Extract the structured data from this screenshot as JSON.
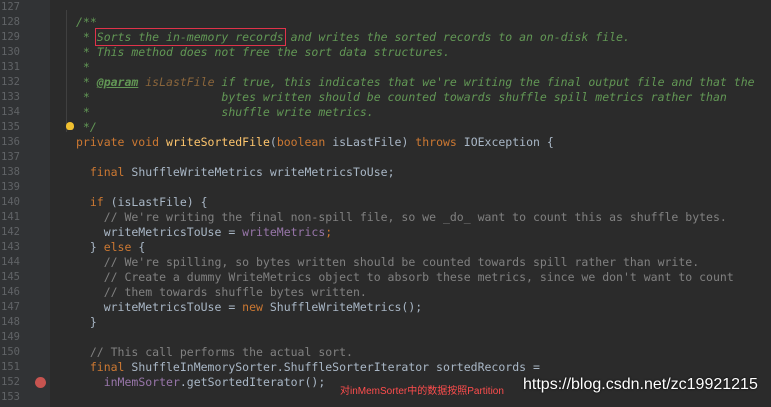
{
  "gutter": {
    "line_numbers": [
      "127",
      "128",
      "129",
      "130",
      "131",
      "132",
      "133",
      "134",
      "135",
      "136",
      "137",
      "138",
      "139",
      "140",
      "141",
      "142",
      "143",
      "144",
      "145",
      "146",
      "147",
      "148",
      "149",
      "150",
      "151",
      "152",
      "153"
    ]
  },
  "code": {
    "l127": "",
    "l128": "/**",
    "l129_pre": " * ",
    "l129_boxed": "Sorts the in-memory records",
    "l129_post": " and writes the sorted records to an on-disk file.",
    "l130": " * This method does not free the sort data structures.",
    "l131": " *",
    "l132_pre": " * ",
    "l132_tag": "@param",
    "l132_param": " isLastFile",
    "l132_post": " if true, this indicates that we're writing the final output file and that the",
    "l133": " *                   bytes written should be counted towards shuffle spill metrics rather than",
    "l134": " *                   shuffle write metrics.",
    "l135": " */",
    "l136_kw1": "private void ",
    "l136_fn": "writeSortedFile",
    "l136_p1": "(",
    "l136_kw2": "boolean",
    "l136_p2": " isLastFile) ",
    "l136_kw3": "throws",
    "l136_p3": " IOException {",
    "l137": "",
    "l138_kw": "  final",
    "l138_rest": " ShuffleWriteMetrics writeMetricsToUse;",
    "l139": "",
    "l140_kw": "  if",
    "l140_rest": " (isLastFile) {",
    "l141": "    // We're writing the final non-spill file, so we _do_ want to count this as shuffle bytes.",
    "l142_pre": "    writeMetricsToUse = ",
    "l142_field": "writeMetrics",
    "l142_post": ";",
    "l143_pre": "  } ",
    "l143_kw": "else",
    "l143_post": " {",
    "l144": "    // We're spilling, so bytes written should be counted towards spill rather than write.",
    "l145": "    // Create a dummy WriteMetrics object to absorb these metrics, since we don't want to count",
    "l146": "    // them towards shuffle bytes written.",
    "l147_pre": "    writeMetricsToUse = ",
    "l147_kw": "new",
    "l147_post": " ShuffleWriteMetrics();",
    "l148": "  }",
    "l149": "",
    "l150": "  // This call performs the actual sort.",
    "l151_kw": "  final",
    "l151_rest": " ShuffleInMemorySorter.ShuffleSorterIterator sortedRecords =",
    "l152_pre": "    ",
    "l152_field": "inMemSorter",
    "l152_post": ".getSortedIterator();",
    "l153": ""
  },
  "overlay": {
    "note": "对inMemSorter中的数据按照Partition",
    "watermark": "https://blog.csdn.net/zc19921215"
  },
  "colors": {
    "background": "#2b2b2b",
    "keyword": "#cc7832",
    "function": "#ffc66d",
    "doc_comment": "#629755",
    "comment": "#808080",
    "field": "#9876aa",
    "highlight_box": "#e0334a",
    "breakpoint": "#c75450"
  }
}
